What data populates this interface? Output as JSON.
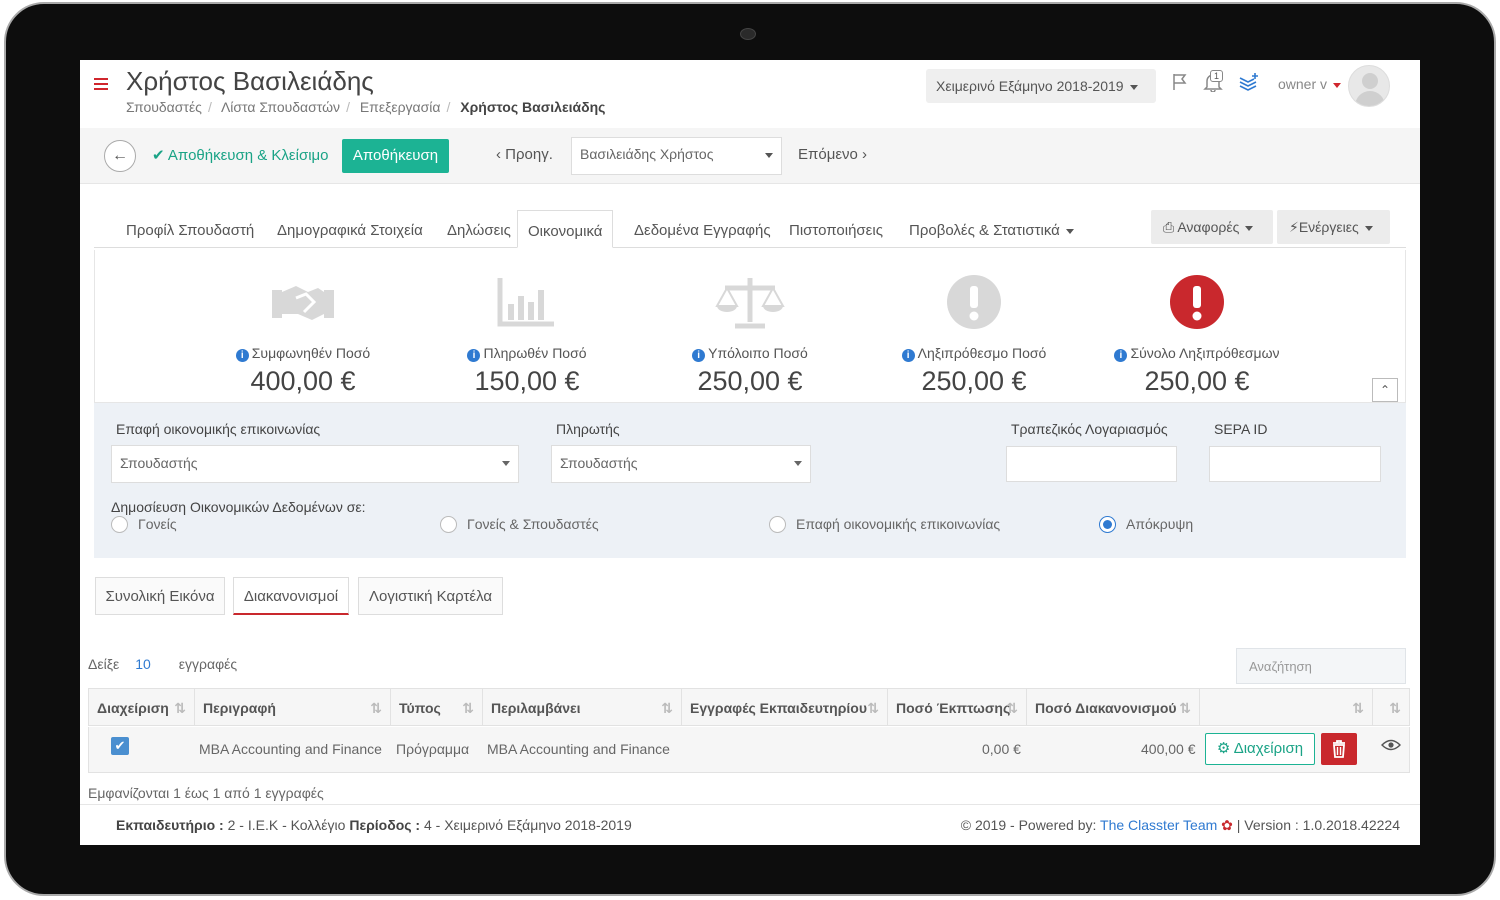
{
  "header": {
    "title": "Χρήστος Βασιλειάδης",
    "breadcrumbs": [
      "Σπουδαστές",
      "Λίστα Σπουδαστών",
      "Επεξεργασία",
      "Χρήστος Βασιλειάδης"
    ],
    "semester": "Χειμερινό Εξάμηνο 2018-2019",
    "notification_count": "1",
    "user": "owner v"
  },
  "toolbar": {
    "save_close": "Αποθήκευση & Κλείσιμο",
    "save": "Αποθήκευση",
    "prev": "Προηγ.",
    "student_select": "Βασιλειάδης Χρήστος",
    "next": "Επόμενο"
  },
  "tabs": [
    "Προφίλ Σπουδαστή",
    "Δημογραφικά Στοιχεία",
    "Δηλώσεις",
    "Οικονομικά",
    "Δεδομένα Εγγραφής",
    "Πιστοποιήσεις",
    "Προβολές & Στατιστικά"
  ],
  "active_tab": "Οικονομικά",
  "actions": {
    "reports": "Αναφορές",
    "actions": "Ενέργειες"
  },
  "stats": [
    {
      "label": "Συμφωνηθέν Ποσό",
      "amount": "400,00 €",
      "icon": "handshake-icon"
    },
    {
      "label": "Πληρωθέν Ποσό",
      "amount": "150,00 €",
      "icon": "bar-chart-icon"
    },
    {
      "label": "Υπόλοιπο Ποσό",
      "amount": "250,00 €",
      "icon": "balance-scale-icon"
    },
    {
      "label": "Ληξιπρόθεσμο Ποσό",
      "amount": "250,00 €",
      "icon": "exclamation-circle-icon"
    },
    {
      "label": "Σύνολο Ληξιπρόθεσμων",
      "amount": "250,00 €",
      "icon": "exclamation-circle-red-icon"
    }
  ],
  "form": {
    "contact_label": "Επαφή οικονομικής επικοινωνίας",
    "contact_value": "Σπουδαστής",
    "payer_label": "Πληρωτής",
    "payer_value": "Σπουδαστής",
    "bank_label": "Τραπεζικός Λογαριασμός",
    "sepa_label": "SEPA ID",
    "publish_label": "Δημοσίευση Οικονομικών Δεδομένων σε:",
    "radios": [
      "Γονείς",
      "Γονείς & Σπουδαστές",
      "Επαφή οικονομικής επικοινωνίας",
      "Απόκρυψη"
    ],
    "selected_radio": "Απόκρυψη"
  },
  "subtabs": [
    "Συνολική Εικόνα",
    "Διακανονισμοί",
    "Λογιστική Καρτέλα"
  ],
  "active_subtab": "Διακανονισμοί",
  "table": {
    "show_label": "Δείξε",
    "page_size": "10",
    "records_label": "εγγραφές",
    "search_placeholder": "Αναζήτηση",
    "headers": [
      "Διαχείριση",
      "Περιγραφή",
      "Τύπος",
      "Περιλαμβάνει",
      "Εγγραφές Εκπαιδευτηρίου",
      "Ποσό Έκπτωσης",
      "Ποσό Διακανονισμού",
      "",
      ""
    ],
    "rows": [
      {
        "description": "MBA Accounting and Finance",
        "type": "Πρόγραμμα",
        "includes": "MBA Accounting and Finance",
        "institution_records": "",
        "discount": "0,00 €",
        "amount": "400,00 €",
        "manage_label": "Διαχείριση"
      }
    ],
    "summary": "Εμφανίζονται 1 έως 1 από 1 εγγραφές"
  },
  "footer": {
    "institution_label": "Εκπαιδευτήριο :",
    "institution_value": "2 - Ι.Ε.Κ - Κολλέγιο",
    "period_label": "Περίοδος :",
    "period_value": "4 - Χειμερινό Εξάμηνο 2018-2019",
    "powered_prefix": "2019 - Powered by:",
    "team": "The Classter Team",
    "version": "| Version : 1.0.2018.42224"
  },
  "colors": {
    "accent": "#1cb394",
    "danger": "#c9282d",
    "link": "#2f7ad1",
    "panel": "#edf1f6"
  }
}
